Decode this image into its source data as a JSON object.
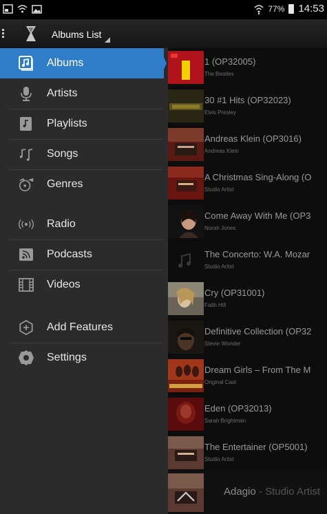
{
  "status": {
    "battery": "77%",
    "time": "14:53"
  },
  "header": {
    "title": "Albums List"
  },
  "nav": {
    "items": [
      {
        "label": "Albums",
        "icon": "albums-icon"
      },
      {
        "label": "Artists",
        "icon": "microphone-icon"
      },
      {
        "label": "Playlists",
        "icon": "playlist-icon"
      },
      {
        "label": "Songs",
        "icon": "music-note-icon"
      },
      {
        "label": "Genres",
        "icon": "gramophone-icon"
      },
      {
        "label": "Radio",
        "icon": "radio-icon"
      },
      {
        "label": "Podcasts",
        "icon": "podcast-icon"
      },
      {
        "label": "Videos",
        "icon": "film-icon"
      },
      {
        "label": "Add Features",
        "icon": "add-icon"
      },
      {
        "label": "Settings",
        "icon": "gear-icon"
      }
    ]
  },
  "albums": [
    {
      "title": "1 (OP32005)",
      "artist": "The Beatles"
    },
    {
      "title": "30 #1 Hits (OP32023)",
      "artist": "Elvis Presley"
    },
    {
      "title": "Andreas Klein (OP3016)",
      "artist": "Andreas Klein"
    },
    {
      "title": "A Christmas Sing-Along (O",
      "artist": "Studio Artist"
    },
    {
      "title": "Come Away With Me (OP3",
      "artist": "Norah Jones"
    },
    {
      "title": "The Concerto: W.A. Mozar",
      "artist": "Studio Artist"
    },
    {
      "title": "Cry (OP31001)",
      "artist": "Faith Hill"
    },
    {
      "title": "Definitive Collection (OP32",
      "artist": "Stevie Wonder"
    },
    {
      "title": "Dream Girls – From The M",
      "artist": "Original Cast"
    },
    {
      "title": "Eden (OP32013)",
      "artist": "Sarah Brightman"
    },
    {
      "title": "The Entertainer (OP5001)",
      "artist": "Studio Artist"
    }
  ],
  "now_playing": {
    "title": "Adagio",
    "separator": " - ",
    "artist": "Studio Artist"
  },
  "colors": {
    "accent": "#2f7cc7",
    "drawer": "#2b2b2b",
    "list_bg": "#0d0d0d"
  }
}
